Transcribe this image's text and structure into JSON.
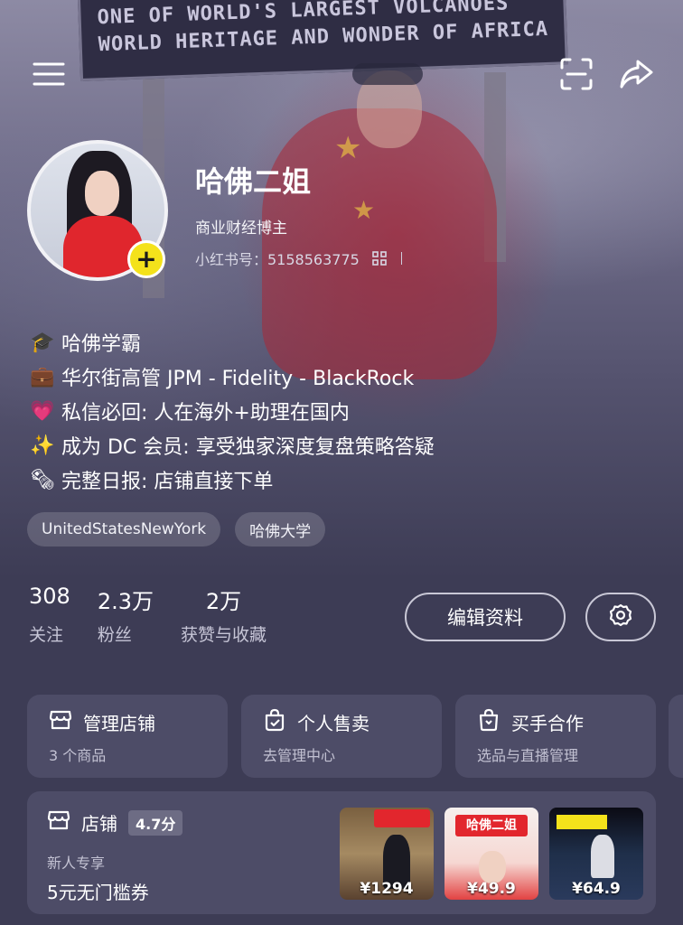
{
  "background": {
    "sign_line_1": "ONE OF WORLD'S LARGEST VOLCANOES",
    "sign_line_2": "WORLD HERITAGE AND WONDER OF AFRICA"
  },
  "topbar": {
    "menu_icon": "hamburger-icon",
    "scan_icon": "scan-icon",
    "share_icon": "share-arrow-icon"
  },
  "profile": {
    "name": "哈佛二姐",
    "role": "商业财经博主",
    "red_id": "小红书号：5158563775",
    "add_badge": "+"
  },
  "bio": [
    {
      "emoji": "🎓",
      "text": "哈佛学霸"
    },
    {
      "emoji": "💼",
      "text": "华尔街高管 JPM - Fidelity - BlackRock"
    },
    {
      "emoji": "💗",
      "text": "私信必回: 人在海外+助理在国内"
    },
    {
      "emoji": "✨",
      "text": "成为 DC 会员: 享受独家深度复盘策略答疑"
    },
    {
      "emoji": "🗞",
      "text": "完整日报: 店铺直接下单"
    }
  ],
  "tags": [
    "UnitedStatesNewYork",
    "哈佛大学"
  ],
  "stats": [
    {
      "value": "308",
      "label": "关注"
    },
    {
      "value": "2.3万",
      "label": "粉丝"
    },
    {
      "value": "2万",
      "label": "获赞与收藏"
    }
  ],
  "actions": {
    "edit_label": "编辑资料",
    "settings_icon": "gear-icon"
  },
  "services": [
    {
      "title": "管理店铺",
      "sub": "3 个商品",
      "icon": "store-icon"
    },
    {
      "title": "个人售卖",
      "sub": "去管理中心",
      "icon": "bag-icon"
    },
    {
      "title": "买手合作",
      "sub": "选品与直播管理",
      "icon": "buyer-bag-icon"
    }
  ],
  "store": {
    "title": "店铺",
    "score": "4.7分",
    "sub": "新人专享",
    "coupon": "5元无门槛券",
    "products": [
      {
        "price": "¥1294"
      },
      {
        "price": "¥49.9",
        "banner": "哈佛二姐"
      },
      {
        "price": "¥64.9"
      }
    ]
  },
  "colors": {
    "background": "#3d3c55",
    "card": "#4d4c67",
    "badge_yellow": "#f4e21b",
    "flag_red": "#e2262d"
  }
}
